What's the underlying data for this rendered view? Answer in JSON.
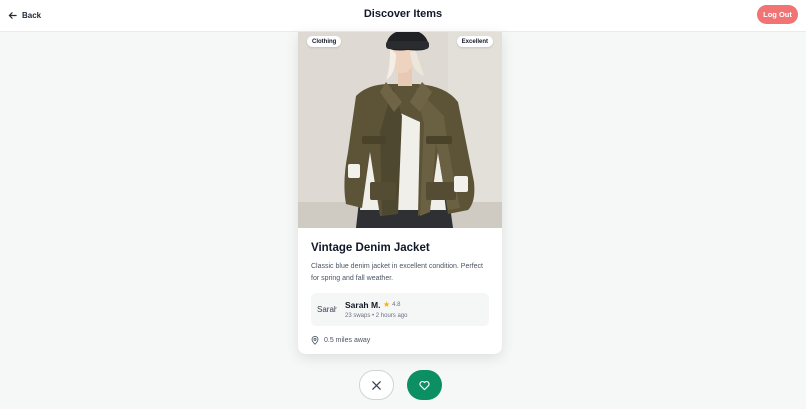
{
  "header": {
    "back_label": "Back",
    "title": "Discover Items",
    "logout_label": "Log Out"
  },
  "item": {
    "category": "Clothing",
    "condition": "Excellent",
    "title": "Vintage Denim Jacket",
    "description": "Classic blue denim jacket in excellent condition. Perfect for spring and fall weather.",
    "owner": {
      "avatar_alt": "Sarah",
      "name": "Sarah M.",
      "rating": "4.8",
      "meta": "23 swaps • 2 hours ago"
    },
    "distance": "0.5 miles away"
  },
  "colors": {
    "accent": "#0b8f63",
    "logout": "#f17373",
    "star": "#f5b301"
  },
  "icons": {
    "back": "arrow-left-icon",
    "star": "star-icon",
    "location": "map-pin-icon",
    "pass": "close-icon",
    "like": "heart-icon"
  }
}
